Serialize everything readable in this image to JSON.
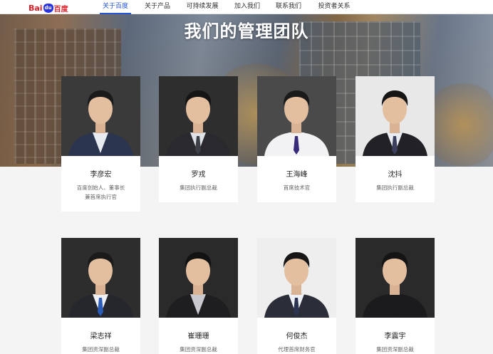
{
  "nav": {
    "logo_bai": "Bai",
    "logo_du": "du",
    "logo_cn": "百度",
    "items": [
      "关于百度",
      "关于产品",
      "可持续发展",
      "加入我们",
      "联系我们",
      "投资者关系"
    ],
    "active_index": 0,
    "accent_color": "#2556d8"
  },
  "hero": {
    "title": "我们的管理团队"
  },
  "team": [
    {
      "name": "李彦宏",
      "title_line1": "百度创始人、董事长",
      "title_line2": "兼首席执行官",
      "bg": "#3a3a3a",
      "suit": "#2b3550",
      "shirt": "#e8ecf2",
      "tie": "",
      "hair": "#1a1a1a"
    },
    {
      "name": "罗戎",
      "title_line1": "集团执行副总裁",
      "title_line2": "",
      "bg": "#2e2e2e",
      "suit": "#2a2a2e",
      "shirt": "#dfe3e8",
      "tie": "#3c3f45",
      "hair": "#151515"
    },
    {
      "name": "王海峰",
      "title_line1": "首席技术官",
      "title_line2": "",
      "bg": "#4a4a4a",
      "suit": "#f2f2f4",
      "shirt": "#f2f2f4",
      "tie": "#3a2a7a",
      "hair": "#1a1a1a"
    },
    {
      "name": "沈抖",
      "title_line1": "集团执行副总裁",
      "title_line2": "",
      "bg": "#e8e8e8",
      "suit": "#222226",
      "shirt": "#e9edf2",
      "tie": "#3b3f5c",
      "hair": "#151515"
    },
    {
      "name": "梁志祥",
      "title_line1": "集团资深副总裁",
      "title_line2": "",
      "bg": "#2d2d2d",
      "suit": "#25272d",
      "shirt": "#eef0f4",
      "tie": "#2d5bb8",
      "hair": "#1a1a1a"
    },
    {
      "name": "崔珊珊",
      "title_line1": "集团资深副总裁",
      "title_line2": "",
      "bg": "#2a2a2a",
      "suit": "#1e1e20",
      "shirt": "#c9c9cf",
      "tie": "",
      "hair": "#121212"
    },
    {
      "name": "何俊杰",
      "title_line1": "代理首席财务官",
      "title_line2": "",
      "bg": "#eeeeee",
      "suit": "#2b2e38",
      "shirt": "#eef1f5",
      "tie": "#2a3350",
      "hair": "#161616"
    },
    {
      "name": "李震宇",
      "title_line1": "集团资深副总裁",
      "title_line2": "",
      "bg": "#2a2a2a",
      "suit": "#1b1b1d",
      "shirt": "#1b1b1d",
      "tie": "",
      "hair": "#141414"
    }
  ]
}
